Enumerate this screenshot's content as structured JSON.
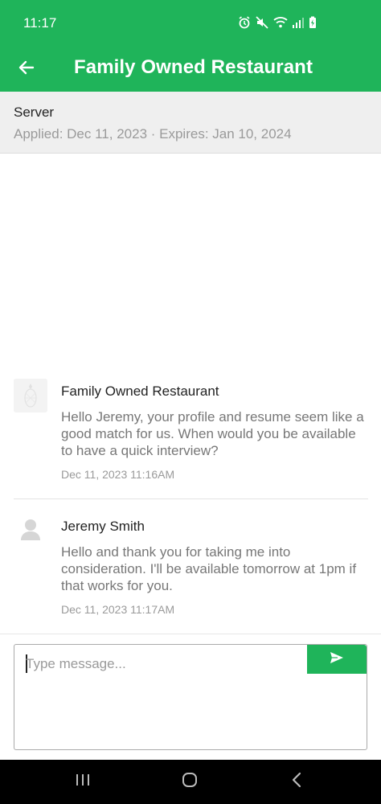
{
  "status_bar": {
    "time": "11:17",
    "icons": [
      "alarm-icon",
      "mute-icon",
      "wifi-icon",
      "signal-icon",
      "battery-charging-icon"
    ]
  },
  "app_bar": {
    "title": "Family Owned Restaurant",
    "back_icon": "back-arrow-icon"
  },
  "job": {
    "title": "Server",
    "meta": "Applied: Dec 11, 2023 · Expires: Jan 10, 2024"
  },
  "messages": [
    {
      "sender": "Family Owned Restaurant",
      "body": "Hello Jeremy, your profile and resume seem like a good match for us. When would you be available to have a quick interview?",
      "time": "Dec 11, 2023 11:16AM",
      "avatar": "restaurant-logo"
    },
    {
      "sender": "Jeremy Smith",
      "body": "Hello and thank you for taking me into consideration. I'll be available tomorrow at 1pm if that works for you.",
      "time": "Dec 11, 2023 11:17AM",
      "avatar": "default-user-avatar"
    }
  ],
  "composer": {
    "placeholder": "Type message...",
    "send_icon": "send-icon"
  },
  "nav_bar": {
    "icons": [
      "recent-apps-icon",
      "home-icon",
      "back-icon"
    ]
  },
  "colors": {
    "primary": "#1fb45a",
    "header_bg": "#efefef",
    "muted_text": "#9a9a9a"
  }
}
